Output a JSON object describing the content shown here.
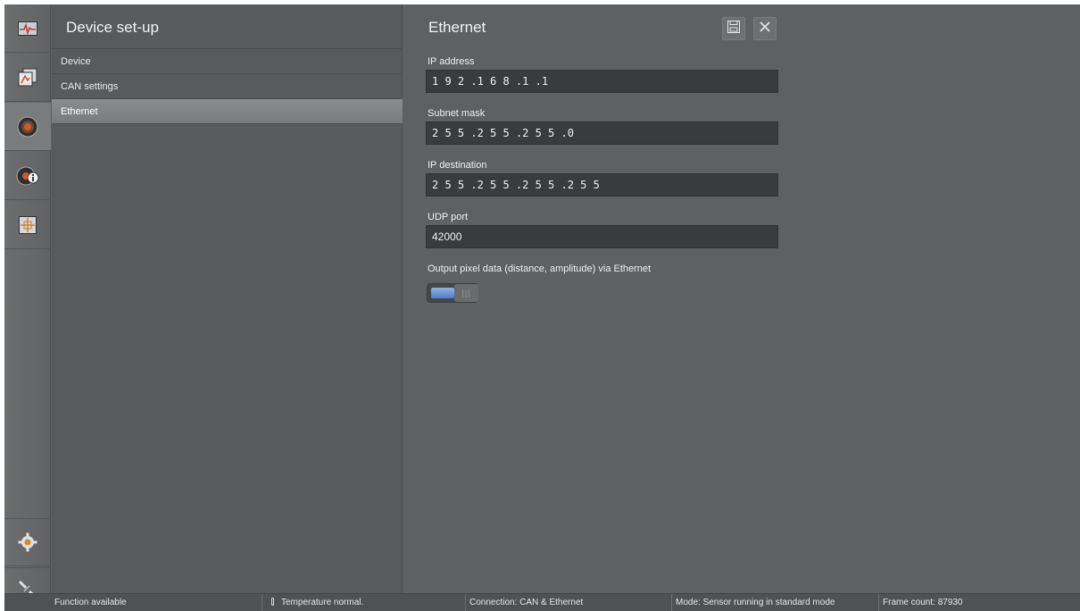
{
  "rail": {
    "items": [
      {
        "icon": "waveform-monitor-icon"
      },
      {
        "icon": "image-document-icon"
      },
      {
        "icon": "sensor-lens-icon"
      },
      {
        "icon": "sensor-info-icon"
      },
      {
        "icon": "crosshair-target-icon"
      }
    ],
    "bottom": [
      {
        "icon": "gear-icon"
      },
      {
        "icon": "connect-plug-icon"
      }
    ]
  },
  "setup": {
    "title": "Device set-up",
    "menu": [
      {
        "label": "Device"
      },
      {
        "label": "CAN settings"
      },
      {
        "label": "Ethernet",
        "selected": true
      }
    ]
  },
  "ethernet": {
    "title": "Ethernet",
    "save_icon": "save-icon",
    "close_icon": "close-icon",
    "fields": [
      {
        "label": "IP address",
        "value": "1 9 2 .1 6 8 .1 .1"
      },
      {
        "label": "Subnet mask",
        "value": "2 5 5 .2 5 5 .2 5 5 .0"
      },
      {
        "label": "IP destination",
        "value": "2 5 5 .2 5 5 .2 5 5 .2 5 5"
      },
      {
        "label": "UDP port",
        "value": "42000"
      }
    ],
    "toggle": {
      "label": "Output pixel data (distance, amplitude) via Ethernet",
      "state": "on",
      "accent": "#5a8ad6"
    }
  },
  "status": {
    "function": "Function available",
    "temperature": "Temperature normal.",
    "connection": "Connection: CAN & Ethernet",
    "mode": "Mode: Sensor running in standard mode",
    "frame_count": "Frame count: 87930"
  }
}
